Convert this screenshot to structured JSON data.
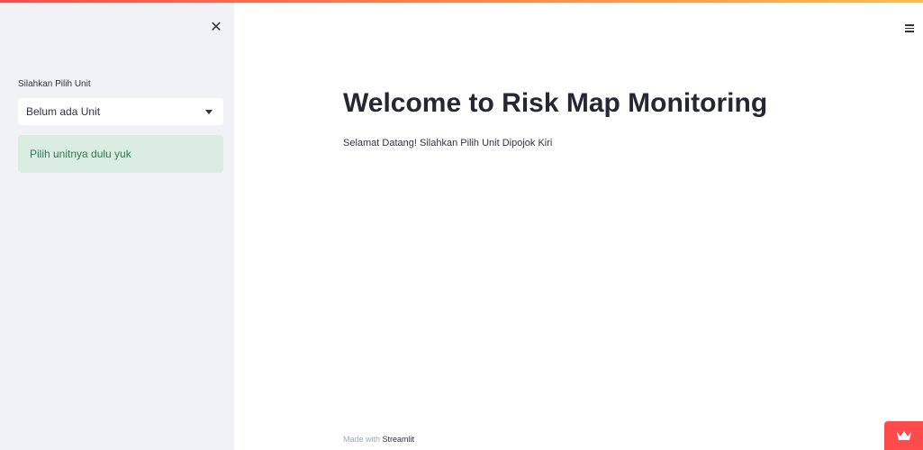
{
  "sidebar": {
    "close_symbol": "✕",
    "select": {
      "label": "Silahkan Pilih Unit",
      "value": "Belum ada Unit"
    },
    "alert": "Pilih unitnya dulu yuk"
  },
  "main": {
    "title": "Welcome to Risk Map Monitoring",
    "subtitle": "Selamat Datang! Silahkan Pilih Unit Dipojok Kiri"
  },
  "footer": {
    "prefix": "Made with ",
    "link": "Streamlit"
  },
  "icons": {
    "close": "close-icon",
    "menu": "hamburger-menu-icon",
    "dropdown": "chevron-down-icon",
    "crown": "crown-icon"
  },
  "colors": {
    "sidebar_bg": "#f0f2f6",
    "alert_bg": "#dbece3",
    "alert_text": "#2e7d4f",
    "accent": "#ff4b4b"
  }
}
